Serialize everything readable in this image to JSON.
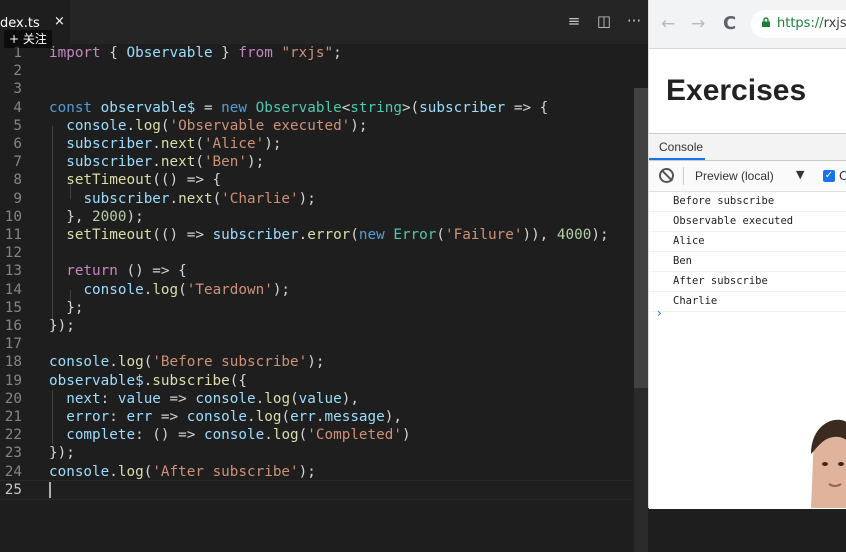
{
  "editor": {
    "tab_label": "dex.ts",
    "tab_close": "×",
    "follow_badge": "+ 关注",
    "actions": [
      "≡",
      "◫",
      "···"
    ],
    "lines": [
      {
        "n": "1",
        "segs": [
          [
            "kw2",
            "import"
          ],
          [
            "punc",
            " { "
          ],
          [
            "var",
            "Observable"
          ],
          [
            "punc",
            " } "
          ],
          [
            "kw2",
            "from"
          ],
          [
            "punc",
            " "
          ],
          [
            "str",
            "\"rxjs\""
          ],
          [
            "punc",
            ";"
          ]
        ]
      },
      {
        "n": "2",
        "segs": []
      },
      {
        "n": "3",
        "segs": []
      },
      {
        "n": "4",
        "segs": [
          [
            "kw",
            "const"
          ],
          [
            "punc",
            " "
          ],
          [
            "var",
            "observable$"
          ],
          [
            "punc",
            " = "
          ],
          [
            "kw",
            "new"
          ],
          [
            "punc",
            " "
          ],
          [
            "typ",
            "Observable"
          ],
          [
            "punc",
            "<"
          ],
          [
            "typ",
            "string"
          ],
          [
            "punc",
            ">("
          ],
          [
            "var",
            "subscriber"
          ],
          [
            "punc",
            " => {"
          ]
        ]
      },
      {
        "n": "5",
        "segs": [
          [
            "punc",
            "  "
          ],
          [
            "var",
            "console"
          ],
          [
            "punc",
            "."
          ],
          [
            "fn",
            "log"
          ],
          [
            "punc",
            "("
          ],
          [
            "str",
            "'Observable executed'"
          ],
          [
            "punc",
            ");"
          ]
        ]
      },
      {
        "n": "6",
        "segs": [
          [
            "punc",
            "  "
          ],
          [
            "var",
            "subscriber"
          ],
          [
            "punc",
            "."
          ],
          [
            "fn",
            "next"
          ],
          [
            "punc",
            "("
          ],
          [
            "str",
            "'Alice'"
          ],
          [
            "punc",
            ");"
          ]
        ]
      },
      {
        "n": "7",
        "segs": [
          [
            "punc",
            "  "
          ],
          [
            "var",
            "subscriber"
          ],
          [
            "punc",
            "."
          ],
          [
            "fn",
            "next"
          ],
          [
            "punc",
            "("
          ],
          [
            "str",
            "'Ben'"
          ],
          [
            "punc",
            ");"
          ]
        ]
      },
      {
        "n": "8",
        "segs": [
          [
            "punc",
            "  "
          ],
          [
            "fn",
            "setTimeout"
          ],
          [
            "punc",
            "(() => {"
          ]
        ]
      },
      {
        "n": "9",
        "segs": [
          [
            "punc",
            "    "
          ],
          [
            "var",
            "subscriber"
          ],
          [
            "punc",
            "."
          ],
          [
            "fn",
            "next"
          ],
          [
            "punc",
            "("
          ],
          [
            "str",
            "'Charlie'"
          ],
          [
            "punc",
            ");"
          ]
        ]
      },
      {
        "n": "10",
        "segs": [
          [
            "punc",
            "  }, "
          ],
          [
            "num",
            "2000"
          ],
          [
            "punc",
            ");"
          ]
        ]
      },
      {
        "n": "11",
        "segs": [
          [
            "punc",
            "  "
          ],
          [
            "fn",
            "setTimeout"
          ],
          [
            "punc",
            "(() => "
          ],
          [
            "var",
            "subscriber"
          ],
          [
            "punc",
            "."
          ],
          [
            "fn",
            "error"
          ],
          [
            "punc",
            "("
          ],
          [
            "kw",
            "new"
          ],
          [
            "punc",
            " "
          ],
          [
            "typ",
            "Error"
          ],
          [
            "punc",
            "("
          ],
          [
            "str",
            "'Failure'"
          ],
          [
            "punc",
            ")), "
          ],
          [
            "num",
            "4000"
          ],
          [
            "punc",
            ");"
          ]
        ]
      },
      {
        "n": "12",
        "segs": []
      },
      {
        "n": "13",
        "segs": [
          [
            "punc",
            "  "
          ],
          [
            "kw2",
            "return"
          ],
          [
            "punc",
            " () => {"
          ]
        ]
      },
      {
        "n": "14",
        "segs": [
          [
            "punc",
            "    "
          ],
          [
            "var",
            "console"
          ],
          [
            "punc",
            "."
          ],
          [
            "fn",
            "log"
          ],
          [
            "punc",
            "("
          ],
          [
            "str",
            "'Teardown'"
          ],
          [
            "punc",
            ");"
          ]
        ]
      },
      {
        "n": "15",
        "segs": [
          [
            "punc",
            "  };"
          ]
        ]
      },
      {
        "n": "16",
        "segs": [
          [
            "punc",
            "});"
          ]
        ]
      },
      {
        "n": "17",
        "segs": []
      },
      {
        "n": "18",
        "segs": [
          [
            "var",
            "console"
          ],
          [
            "punc",
            "."
          ],
          [
            "fn",
            "log"
          ],
          [
            "punc",
            "("
          ],
          [
            "str",
            "'Before subscribe'"
          ],
          [
            "punc",
            ");"
          ]
        ]
      },
      {
        "n": "19",
        "segs": [
          [
            "var",
            "observable$"
          ],
          [
            "punc",
            "."
          ],
          [
            "fn",
            "subscribe"
          ],
          [
            "punc",
            "({"
          ]
        ]
      },
      {
        "n": "20",
        "segs": [
          [
            "punc",
            "  "
          ],
          [
            "var",
            "next"
          ],
          [
            "punc",
            ": "
          ],
          [
            "var",
            "value"
          ],
          [
            "punc",
            " => "
          ],
          [
            "var",
            "console"
          ],
          [
            "punc",
            "."
          ],
          [
            "fn",
            "log"
          ],
          [
            "punc",
            "("
          ],
          [
            "var",
            "value"
          ],
          [
            "punc",
            "),"
          ]
        ]
      },
      {
        "n": "21",
        "segs": [
          [
            "punc",
            "  "
          ],
          [
            "var",
            "error"
          ],
          [
            "punc",
            ": "
          ],
          [
            "var",
            "err"
          ],
          [
            "punc",
            " => "
          ],
          [
            "var",
            "console"
          ],
          [
            "punc",
            "."
          ],
          [
            "fn",
            "log"
          ],
          [
            "punc",
            "("
          ],
          [
            "var",
            "err"
          ],
          [
            "punc",
            "."
          ],
          [
            "var",
            "message"
          ],
          [
            "punc",
            "),"
          ]
        ]
      },
      {
        "n": "22",
        "segs": [
          [
            "punc",
            "  "
          ],
          [
            "var",
            "complete"
          ],
          [
            "punc",
            ": () => "
          ],
          [
            "var",
            "console"
          ],
          [
            "punc",
            "."
          ],
          [
            "fn",
            "log"
          ],
          [
            "punc",
            "("
          ],
          [
            "str",
            "'Completed'"
          ],
          [
            "punc",
            ")"
          ]
        ]
      },
      {
        "n": "23",
        "segs": [
          [
            "punc",
            "});"
          ]
        ]
      },
      {
        "n": "24",
        "segs": [
          [
            "var",
            "console"
          ],
          [
            "punc",
            "."
          ],
          [
            "fn",
            "log"
          ],
          [
            "punc",
            "("
          ],
          [
            "str",
            "'After subscribe'"
          ],
          [
            "punc",
            ");"
          ]
        ]
      },
      {
        "n": "25",
        "segs": []
      }
    ]
  },
  "browser": {
    "back_icon": "←",
    "forward_icon": "→",
    "reload_icon": "C",
    "url_proto": "https://",
    "url_rest": "rxjs-",
    "heading": "Exercises",
    "devtools": {
      "tab": "Console",
      "context": "Preview (local)",
      "context_arrow": "▼",
      "checkbox_mark": "✓",
      "checkbox_label": "C",
      "log": [
        "Before subscribe",
        "Observable executed",
        "Alice",
        "Ben",
        "After subscribe",
        "Charlie"
      ],
      "prompt": "›"
    }
  },
  "colors": {
    "editor_bg": "#1e1e1e",
    "keyword": "#569cd6",
    "control_keyword": "#c586c0",
    "string": "#ce9178",
    "function": "#dcdcaa",
    "variable": "#9cdcfe",
    "type": "#4ec9b0",
    "number": "#b5cea8",
    "accent": "#1a73e8"
  }
}
